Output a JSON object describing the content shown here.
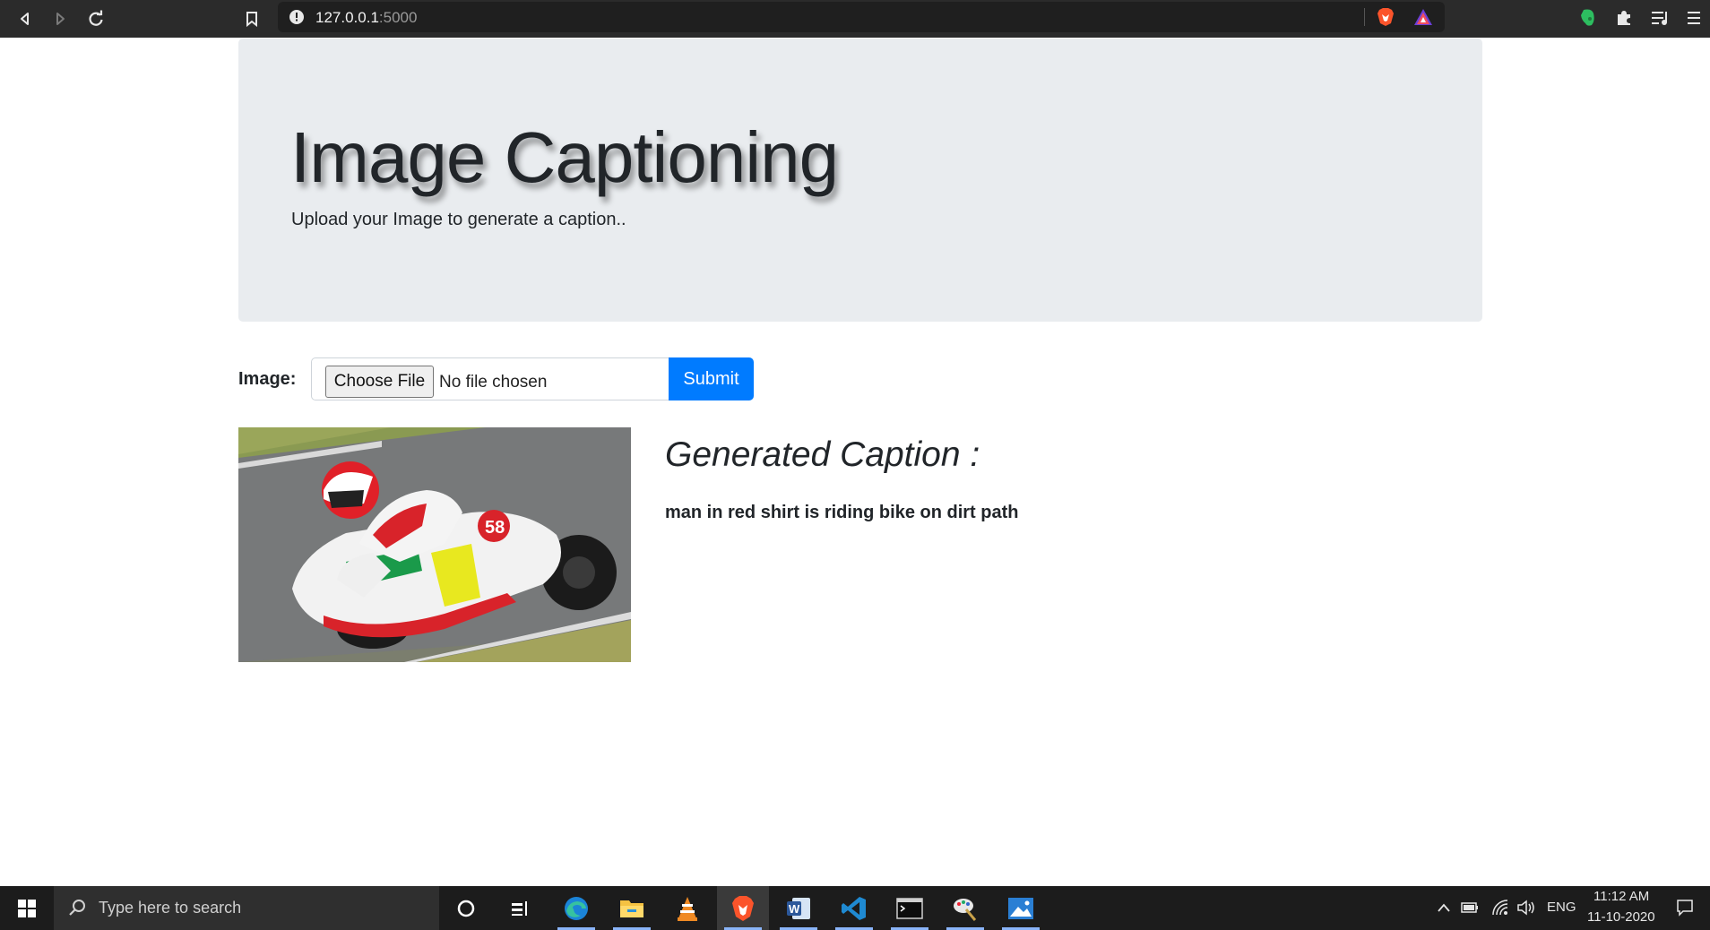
{
  "browser": {
    "url_host": "127.0.0.1",
    "url_port": ":5000"
  },
  "page": {
    "title": "Image Captioning",
    "subtitle": "Upload your Image to generate a caption..",
    "form": {
      "label": "Image:",
      "choose_button": "Choose File",
      "file_status": "No file chosen",
      "submit_label": "Submit"
    },
    "result": {
      "image_alt": "motorcycle racer",
      "heading": "Generated Caption :",
      "caption": "man in red shirt is riding bike on dirt path"
    },
    "accent_color": "#007bff",
    "jumbotron_color": "#e9ecef"
  },
  "taskbar": {
    "search_placeholder": "Type here to search",
    "language": "ENG",
    "time": "11:12 AM",
    "date": "11-10-2020",
    "apps": [
      "cortana-icon",
      "task-view-icon",
      "edge-icon",
      "file-explorer-icon",
      "vlc-icon",
      "brave-icon",
      "word-icon",
      "vscode-icon",
      "terminal-icon",
      "paint-icon",
      "photos-icon"
    ]
  }
}
